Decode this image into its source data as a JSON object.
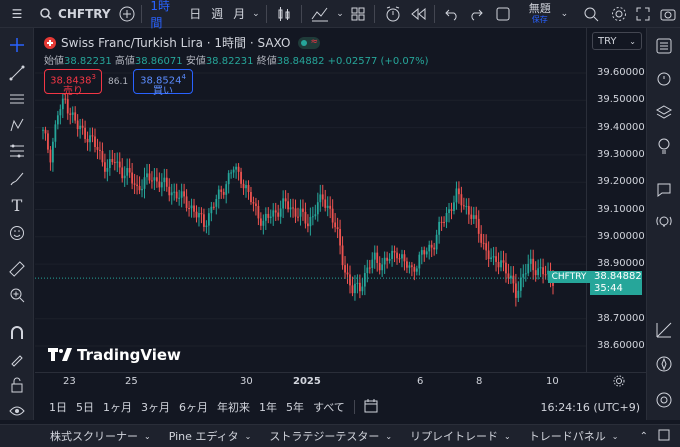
{
  "toolbar": {
    "symbol": "CHFTRY",
    "interval": "1時間",
    "intervals": [
      "日",
      "週",
      "月"
    ],
    "layout_name": "無題",
    "layout_save": "保存"
  },
  "legend": {
    "title": "Swiss Franc/Turkish Lira · 1時間 · SAXO",
    "open_label": "始値",
    "open": "38.82231",
    "high_label": "高値",
    "high": "38.86071",
    "low_label": "安値",
    "low": "38.82231",
    "close_label": "終値",
    "close": "38.84882",
    "change": "+0.02577 (+0.07%)",
    "sell_price": "38.8438",
    "sell_sup": "3",
    "sell_label": "売り",
    "spread": "86.1",
    "buy_price": "38.8524",
    "buy_sup": "4",
    "buy_label": "買い"
  },
  "currency": "TRY",
  "price_axis": {
    "ticks": [
      "39.60000",
      "39.50000",
      "39.40000",
      "39.30000",
      "39.20000",
      "39.10000",
      "39.00000",
      "38.90000",
      "38.70000",
      "38.60000"
    ],
    "last_symbol": "CHFTRY",
    "last_price": "38.84882",
    "countdown": "35:44"
  },
  "time_axis": {
    "ticks": [
      "23",
      "25",
      "30",
      "2025",
      "6",
      "8",
      "10"
    ]
  },
  "watermark": "TradingView",
  "range_buttons": [
    "1日",
    "5日",
    "1ヶ月",
    "3ヶ月",
    "6ヶ月",
    "年初来",
    "1年",
    "5年",
    "すべて"
  ],
  "clock": "16:24:16 (UTC+9)",
  "bottom_tabs": [
    "株式スクリーナー",
    "Pine エディタ",
    "ストラテジーテスター",
    "リプレイトレード",
    "トレードパネル"
  ],
  "chart_data": {
    "type": "candlestick",
    "symbol": "CHFTRY",
    "interval": "1時間",
    "ylim": [
      38.6,
      39.6
    ],
    "x_ticks": [
      "23",
      "25",
      "30",
      "2025",
      "6",
      "8",
      "10"
    ],
    "close_profile": [
      [
        0,
        39.38
      ],
      [
        3,
        39.3
      ],
      [
        6,
        39.45
      ],
      [
        9,
        39.5
      ],
      [
        11,
        39.46
      ],
      [
        14,
        39.4
      ],
      [
        17,
        39.38
      ],
      [
        20,
        39.35
      ],
      [
        23,
        39.3
      ],
      [
        26,
        39.25
      ],
      [
        29,
        39.28
      ],
      [
        32,
        39.24
      ],
      [
        35,
        39.22
      ],
      [
        38,
        39.18
      ],
      [
        41,
        39.2
      ],
      [
        44,
        39.22
      ],
      [
        47,
        39.2
      ],
      [
        50,
        39.18
      ],
      [
        53,
        39.16
      ],
      [
        56,
        39.14
      ],
      [
        59,
        39.12
      ],
      [
        62,
        39.08
      ],
      [
        65,
        39.05
      ],
      [
        68,
        39.1
      ],
      [
        71,
        39.15
      ],
      [
        74,
        39.2
      ],
      [
        77,
        39.25
      ],
      [
        80,
        39.22
      ],
      [
        83,
        39.15
      ],
      [
        86,
        39.1
      ],
      [
        89,
        39.05
      ],
      [
        92,
        39.08
      ],
      [
        95,
        39.1
      ],
      [
        98,
        39.12
      ],
      [
        101,
        39.1
      ],
      [
        104,
        39.08
      ],
      [
        107,
        39.05
      ],
      [
        110,
        39.1
      ],
      [
        113,
        39.14
      ],
      [
        116,
        39.1
      ],
      [
        119,
        39.0
      ],
      [
        122,
        38.88
      ],
      [
        125,
        38.8
      ],
      [
        128,
        38.82
      ],
      [
        131,
        38.88
      ],
      [
        134,
        38.92
      ],
      [
        137,
        38.9
      ],
      [
        140,
        38.92
      ],
      [
        143,
        38.95
      ],
      [
        146,
        38.9
      ],
      [
        149,
        38.88
      ],
      [
        152,
        38.92
      ],
      [
        155,
        38.95
      ],
      [
        158,
        38.98
      ],
      [
        161,
        39.05
      ],
      [
        164,
        39.1
      ],
      [
        167,
        39.15
      ],
      [
        170,
        39.12
      ],
      [
        173,
        39.08
      ],
      [
        176,
        39.02
      ],
      [
        179,
        38.95
      ],
      [
        182,
        38.9
      ],
      [
        185,
        38.92
      ],
      [
        188,
        38.85
      ],
      [
        191,
        38.8
      ],
      [
        194,
        38.86
      ],
      [
        197,
        38.9
      ],
      [
        200,
        38.88
      ],
      [
        203,
        38.86
      ],
      [
        206,
        38.85
      ]
    ],
    "last_close": 38.84882
  }
}
